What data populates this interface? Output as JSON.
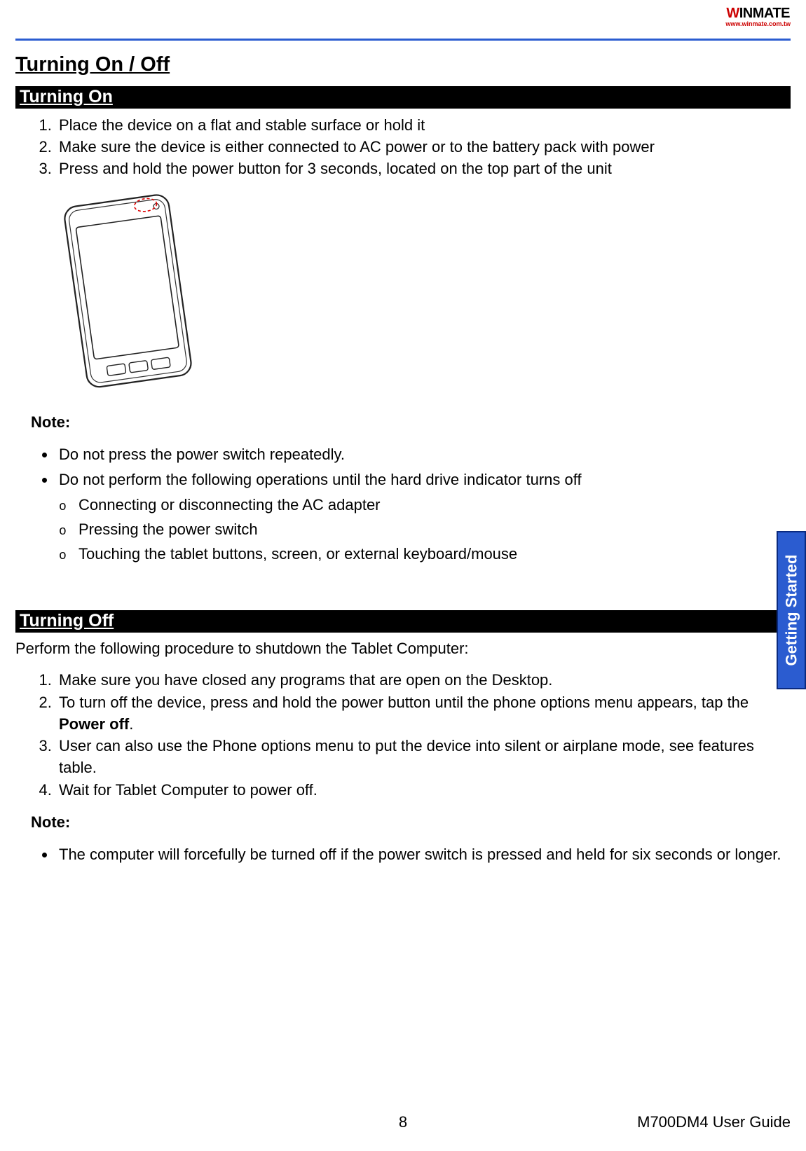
{
  "logo": {
    "brand_w": "W",
    "brand_rest": "INMATE",
    "url": "www.winmate.com.tw"
  },
  "page_title": "Turning On / Off",
  "side_tab": "Getting Started",
  "section_on": {
    "heading": "Turning On",
    "steps": [
      "Place the device on a flat and stable surface or hold it",
      "Make sure the device is either connected to AC power or to the battery pack with power",
      "Press and hold the power button for 3 seconds, located on the top part of the unit"
    ],
    "note_label": "Note:",
    "bullets": [
      "Do not press the power switch repeatedly.",
      "Do not perform the following operations until the hard drive indicator turns off"
    ],
    "sub_bullets": [
      "Connecting or disconnecting the AC adapter",
      "Pressing the power switch",
      "Touching the tablet buttons, screen, or external keyboard/mouse"
    ]
  },
  "section_off": {
    "heading": "Turning Off",
    "intro": "Perform the following procedure to shutdown the Tablet Computer:",
    "step1": "Make sure you have closed any programs that are open on the Desktop.",
    "step2_a": "To turn off the device, press and hold the power button until the phone options menu appears, tap the ",
    "step2_b": "Power off",
    "step2_c": ".",
    "step3": "User can also use the Phone options menu to put the device into silent or airplane mode, see features table.",
    "step4": "Wait for Tablet Computer to power off.",
    "note_label": "Note:",
    "note_bullet": "The computer will forcefully be turned off if the power switch is pressed and held for six seconds or longer."
  },
  "footer": {
    "page_number": "8",
    "doc_name": "M700DM4 User Guide"
  }
}
